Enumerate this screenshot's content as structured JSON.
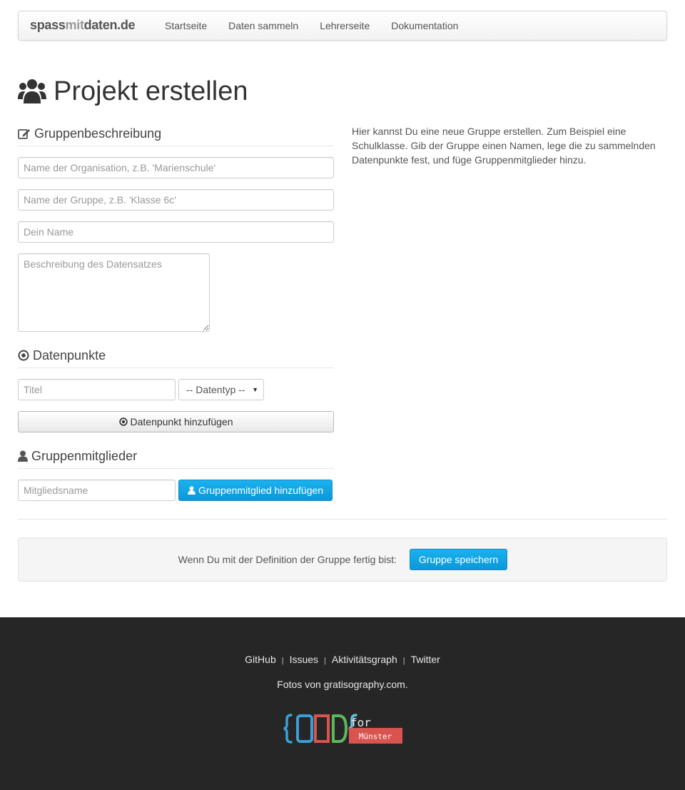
{
  "navbar": {
    "brand_pre": "spass",
    "brand_mid": "mit",
    "brand_post": "daten.de",
    "links": [
      "Startseite",
      "Daten sammeln",
      "Lehrerseite",
      "Dokumentation"
    ]
  },
  "page": {
    "title": "Projekt erstellen"
  },
  "description_section": {
    "heading": "Gruppenbeschreibung",
    "org_placeholder": "Name der Organisation, z.B. 'Marienschule'",
    "group_placeholder": "Name der Gruppe, z.B. 'Klasse 6c'",
    "name_placeholder": "Dein Name",
    "desc_placeholder": "Beschreibung des Datensatzes"
  },
  "datapoints_section": {
    "heading": "Datenpunkte",
    "title_placeholder": "Titel",
    "type_select": "-- Datentyp --",
    "add_button": "Datenpunkt hinzufügen"
  },
  "members_section": {
    "heading": "Gruppenmitglieder",
    "member_placeholder": "Mitgliedsname",
    "add_button": "Gruppenmitglied hinzufügen"
  },
  "info": {
    "text": "Hier kannst Du eine neue Gruppe erstellen. Zum Beispiel eine Schulklasse. Gib der Gruppe einen Namen, lege die zu sammelnden Datenpunkte fest, und füge Gruppenmitglieder hinzu."
  },
  "save": {
    "text": "Wenn Du mit der Definition der Gruppe fertig bist:",
    "button": "Gruppe speichern"
  },
  "footer": {
    "links": [
      "GitHub",
      "Issues",
      "Aktivitätsgraph",
      "Twitter"
    ],
    "separator": "|",
    "credit": "Fotos von gratisography.com.",
    "logo_word": "for",
    "logo_city": "Münster"
  },
  "colors": {
    "primary": "#0a98d8",
    "footer_bg": "#262626",
    "logo_blue": "#3a9fd8",
    "logo_red": "#d9534f",
    "logo_green": "#5cb85c"
  },
  "icons": {
    "title": "users-icon",
    "description": "edit-icon",
    "datapoints": "dot-circle-icon",
    "members": "user-icon"
  }
}
